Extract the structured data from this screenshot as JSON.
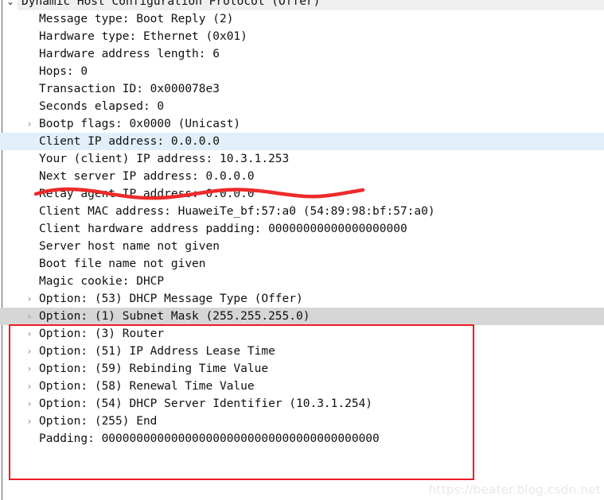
{
  "pane": {
    "title": "packet-details",
    "top_partial_row": "Dynamic Host Configuration Protocol (Offer)"
  },
  "colors": {
    "selected_row_gray": "#d6d6d6",
    "selected_row_blue": "#e2effb",
    "header_row_gray": "#efefef",
    "annotation_red": "#ec1c24",
    "text": "#101010",
    "chevron_gray": "#a9a9a9",
    "watermark": "#e8e8e8"
  },
  "icons": {
    "expanded": "⌄",
    "collapsed": "›"
  },
  "tree_rows": [
    {
      "text": "Dynamic Host Configuration Protocol (Offer)",
      "level": 0,
      "state": "expanded",
      "highlight": "gray-top"
    },
    {
      "text": "Message type: Boot Reply (2)",
      "level": 1,
      "state": "leaf",
      "highlight": "none"
    },
    {
      "text": "Hardware type: Ethernet (0x01)",
      "level": 1,
      "state": "leaf",
      "highlight": "none"
    },
    {
      "text": "Hardware address length: 6",
      "level": 1,
      "state": "leaf",
      "highlight": "none"
    },
    {
      "text": "Hops: 0",
      "level": 1,
      "state": "leaf",
      "highlight": "none"
    },
    {
      "text": "Transaction ID: 0x000078e3",
      "level": 1,
      "state": "leaf",
      "highlight": "none"
    },
    {
      "text": "Seconds elapsed: 0",
      "level": 1,
      "state": "leaf",
      "highlight": "none"
    },
    {
      "text": "Bootp flags: 0x0000 (Unicast)",
      "level": 1,
      "state": "collapsed",
      "highlight": "none"
    },
    {
      "text": "Client IP address: 0.0.0.0",
      "level": 1,
      "state": "leaf",
      "highlight": "blue"
    },
    {
      "text": "Your (client) IP address: 10.3.1.253",
      "level": 1,
      "state": "leaf",
      "highlight": "none"
    },
    {
      "text": "Next server IP address: 0.0.0.0",
      "level": 1,
      "state": "leaf",
      "highlight": "none"
    },
    {
      "text": "Relay agent IP address: 0.0.0.0",
      "level": 1,
      "state": "leaf",
      "highlight": "none"
    },
    {
      "text": "Client MAC address: HuaweiTe_bf:57:a0 (54:89:98:bf:57:a0)",
      "level": 1,
      "state": "leaf",
      "highlight": "none"
    },
    {
      "text": "Client hardware address padding: 00000000000000000000",
      "level": 1,
      "state": "leaf",
      "highlight": "none"
    },
    {
      "text": "Server host name not given",
      "level": 1,
      "state": "leaf",
      "highlight": "none"
    },
    {
      "text": "Boot file name not given",
      "level": 1,
      "state": "leaf",
      "highlight": "none"
    },
    {
      "text": "Magic cookie: DHCP",
      "level": 1,
      "state": "leaf",
      "highlight": "none"
    },
    {
      "text": "Option: (53) DHCP Message Type (Offer)",
      "level": 1,
      "state": "collapsed",
      "highlight": "none"
    },
    {
      "text": "Option: (1) Subnet Mask (255.255.255.0)",
      "level": 1,
      "state": "collapsed",
      "highlight": "gray"
    },
    {
      "text": "Option: (3) Router",
      "level": 1,
      "state": "collapsed",
      "highlight": "none"
    },
    {
      "text": "Option: (51) IP Address Lease Time",
      "level": 1,
      "state": "collapsed",
      "highlight": "none"
    },
    {
      "text": "Option: (59) Rebinding Time Value",
      "level": 1,
      "state": "collapsed",
      "highlight": "none"
    },
    {
      "text": "Option: (58) Renewal Time Value",
      "level": 1,
      "state": "collapsed",
      "highlight": "none"
    },
    {
      "text": "Option: (54) DHCP Server Identifier (10.3.1.254)",
      "level": 1,
      "state": "collapsed",
      "highlight": "none"
    },
    {
      "text": "Option: (255) End",
      "level": 1,
      "state": "collapsed",
      "highlight": "none"
    },
    {
      "text": "Padding: 0000000000000000000000000000000000000000",
      "level": 1,
      "state": "leaf",
      "highlight": "none"
    }
  ],
  "annotations": {
    "underline_target": "Your (client) IP address: 10.3.1.253",
    "box_target": "DHCP options list"
  },
  "watermark": {
    "text": "https://beater.blog.csdn.net"
  }
}
